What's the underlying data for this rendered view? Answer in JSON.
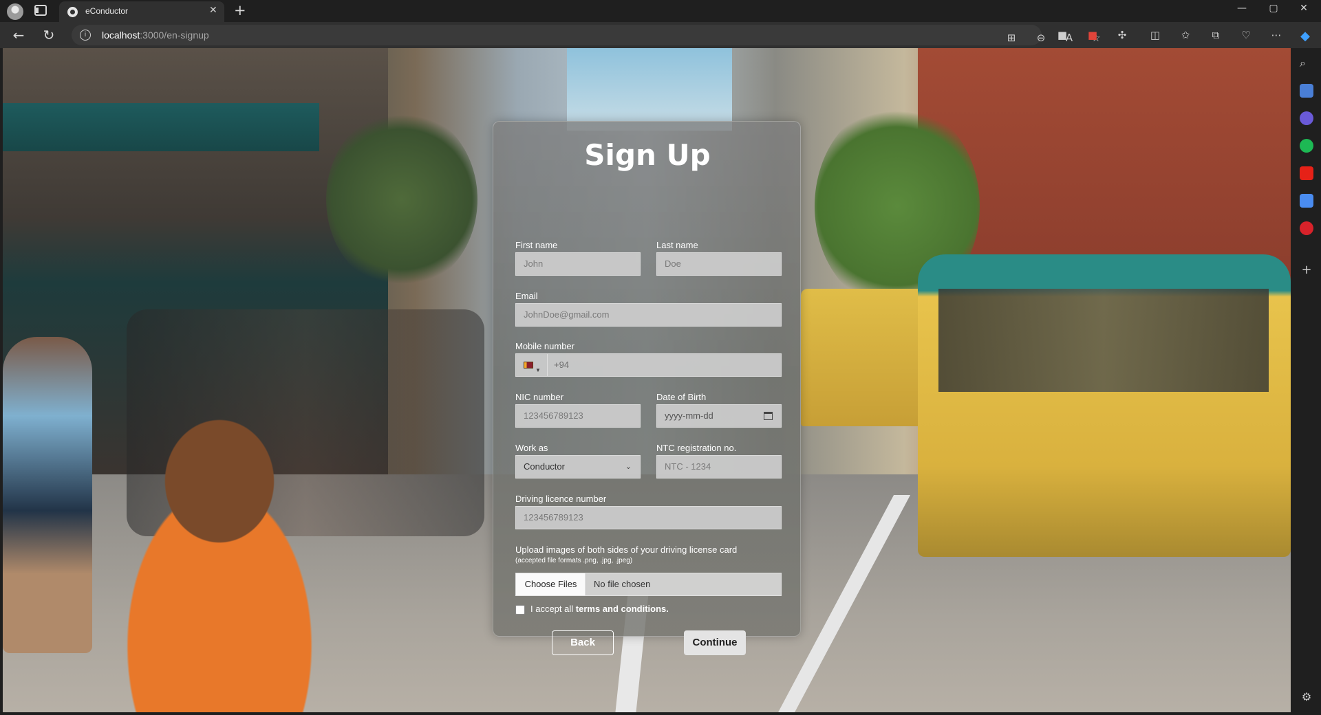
{
  "browser": {
    "tab_title": "eConductor",
    "tab_close": "✕",
    "new_tab": "+",
    "url_host": "localhost",
    "url_path": ":3000/en-signup",
    "info_glyph": "i",
    "window_controls": {
      "minimize": "—",
      "maximize": "▢",
      "close": "✕"
    },
    "nav": {
      "back": "←",
      "reload": "↻"
    },
    "toolbar_icons": [
      "app-icon",
      "zoom-out-icon",
      "read-aloud-icon",
      "favorite-star-icon",
      "extension-black-icon",
      "extension-red-icon",
      "extensions-puzzle-icon",
      "split-screen-icon",
      "favorites-icon",
      "collections-icon",
      "browser-essentials-icon",
      "more-icon",
      "copilot-icon"
    ],
    "sidebar_icons": [
      "search-icon",
      "shopping-tag-icon",
      "copilot-sidebar-icon",
      "spotify-icon",
      "youtube-icon",
      "translate-icon",
      "record-icon",
      "add-icon",
      "settings-icon"
    ]
  },
  "form": {
    "title": "Sign Up",
    "first_name": {
      "label": "First name",
      "placeholder": "John"
    },
    "last_name": {
      "label": "Last name",
      "placeholder": "Doe"
    },
    "email": {
      "label": "Email",
      "placeholder": "JohnDoe@gmail.com"
    },
    "mobile": {
      "label": "Mobile number",
      "value": "+94",
      "flag": "LK"
    },
    "nic": {
      "label": "NIC number",
      "placeholder": "123456789123"
    },
    "dob": {
      "label": "Date of Birth",
      "placeholder": "yyyy-mm-dd"
    },
    "work_as": {
      "label": "Work as",
      "selected": "Conductor"
    },
    "ntc": {
      "label": "NTC registration no.",
      "placeholder": "NTC - 1234"
    },
    "licence": {
      "label": "Driving licence number",
      "placeholder": "123456789123"
    },
    "upload": {
      "label": "Upload images of both sides of your driving license card",
      "hint": "(accepted file formats .png, .jpg, .jpeg)",
      "button": "Choose Files",
      "status": "No file chosen"
    },
    "terms": {
      "prefix": "I accept all",
      "link": "terms and conditions."
    },
    "back_button": "Back",
    "continue_button": "Continue"
  },
  "colors": {
    "chrome_dark": "#1f1f1f",
    "tab_bg": "#303030",
    "card_glass": "#7d7d7d",
    "field_bg": "#cdcdcd"
  }
}
